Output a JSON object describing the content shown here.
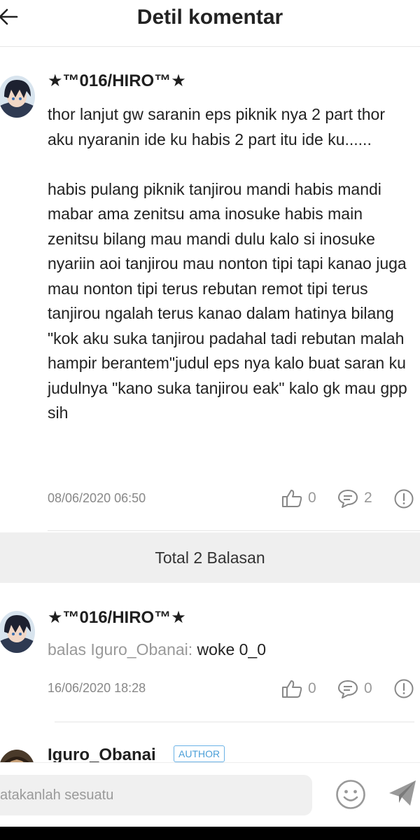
{
  "header": {
    "title": "Detil komentar"
  },
  "comment": {
    "username": "★™016/HIRO™★",
    "paragraph1": "thor lanjut gw saranin eps piknik nya 2 part thor aku nyaranin ide ku habis 2 part itu ide ku......",
    "paragraph2": "habis pulang piknik tanjirou mandi habis mandi mabar ama zenitsu ama inosuke habis main zenitsu bilang mau mandi dulu kalo si inosuke nyariin aoi tanjirou mau nonton tipi tapi kanao juga mau nonton tipi terus rebutan remot tipi terus tanjirou ngalah terus kanao dalam hatinya bilang \"kok aku suka tanjirou padahal tadi rebutan malah hampir berantem\"judul eps nya kalo buat saran ku judulnya \"kano suka tanjirou eak\" kalo gk mau gpp sih",
    "timestamp": "08/06/2020 06:50",
    "likes": "0",
    "replies": "2"
  },
  "replies_section": {
    "label": "Total 2 Balasan"
  },
  "reply1": {
    "username": "★™016/HIRO™★",
    "prefix": "balas Iguro_Obanai:",
    "text": "woke 0_0",
    "timestamp": "16/06/2020 18:28",
    "likes": "0",
    "replies": "0"
  },
  "reply2": {
    "username": "Iguro_Obanai",
    "badge": "AUTHOR"
  },
  "input": {
    "placeholder": "atakanlah sesuatu"
  },
  "icons": {
    "back": "arrow-left-icon",
    "like": "thumbs-up-icon",
    "comment": "speech-bubble-icon",
    "report": "exclamation-circle-icon",
    "emoji": "smiley-icon",
    "send": "paper-plane-icon"
  }
}
